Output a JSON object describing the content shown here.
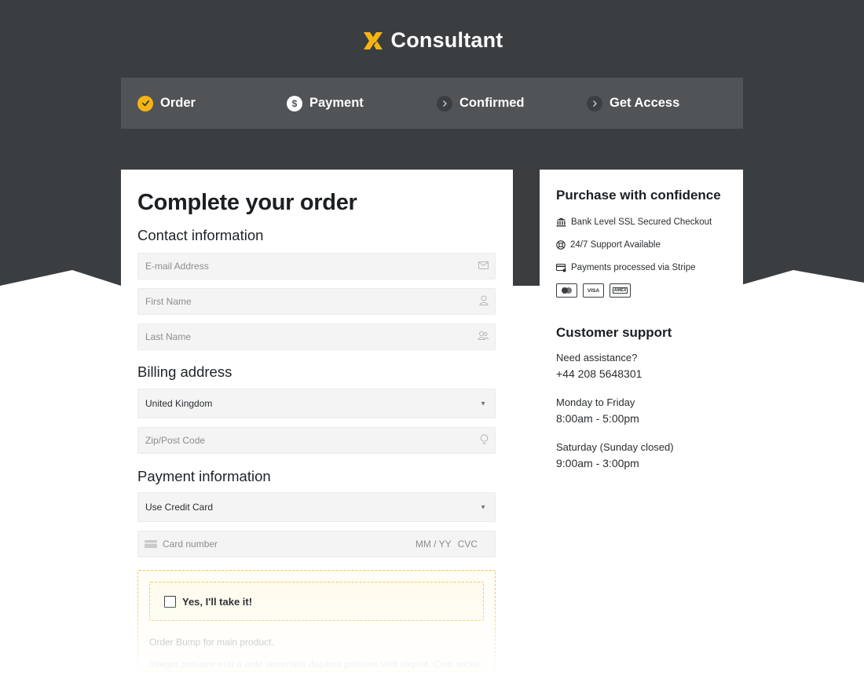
{
  "brand": {
    "name": "Consultant",
    "accent": "#f6b413",
    "dark_bg": "#3a3e41",
    "steps_bg": "#505457"
  },
  "steps": [
    {
      "label": "Order",
      "icon": "check-circle-icon",
      "state": "done"
    },
    {
      "label": "Payment",
      "icon": "dollar-circle-icon",
      "state": "current"
    },
    {
      "label": "Confirmed",
      "icon": "chevron-circle-icon",
      "state": "pending"
    },
    {
      "label": "Get Access",
      "icon": "chevron-circle-icon",
      "state": "pending"
    }
  ],
  "main": {
    "title": "Complete your order",
    "contact": {
      "title": "Contact information",
      "email_placeholder": "E-mail Address",
      "first_name_placeholder": "First Name",
      "last_name_placeholder": "Last Name"
    },
    "billing": {
      "title": "Billing address",
      "country_value": "United Kingdom",
      "zip_placeholder": "Zip/Post Code"
    },
    "payment": {
      "title": "Payment information",
      "method_value": "Use Credit Card",
      "card_placeholder": "Card number",
      "expiry_placeholder": "MM / YY",
      "cvc_placeholder": "CVC"
    },
    "bump": {
      "checkbox_label": "Yes, I'll take it!",
      "description": "Order Bump for main product.",
      "description_2": "Integer posuere erat a ante venenatis dapibus posuere velit aliquet. Cum sociis"
    }
  },
  "side": {
    "title": "Purchase with confidence",
    "trust": [
      {
        "text": "Bank Level SSL Secured Checkout",
        "icon": "bank-icon"
      },
      {
        "text": "24/7 Support Available",
        "icon": "lifebuoy-icon"
      },
      {
        "text": "Payments processed via Stripe",
        "icon": "card-icon"
      }
    ],
    "pay_icons": [
      "mastercard-icon",
      "visa-icon",
      "amex-icon"
    ],
    "visa_label": "VISA",
    "amex_label": "AMEX",
    "support": {
      "title": "Customer support",
      "need_label": "Need assistance?",
      "phone": "+44 208 5648301",
      "weekday_label": "Monday to Friday",
      "weekday_hours": "8:00am - 5:00pm",
      "saturday_label": "Saturday (Sunday closed)",
      "saturday_hours": "9:00am - 3:00pm"
    }
  }
}
